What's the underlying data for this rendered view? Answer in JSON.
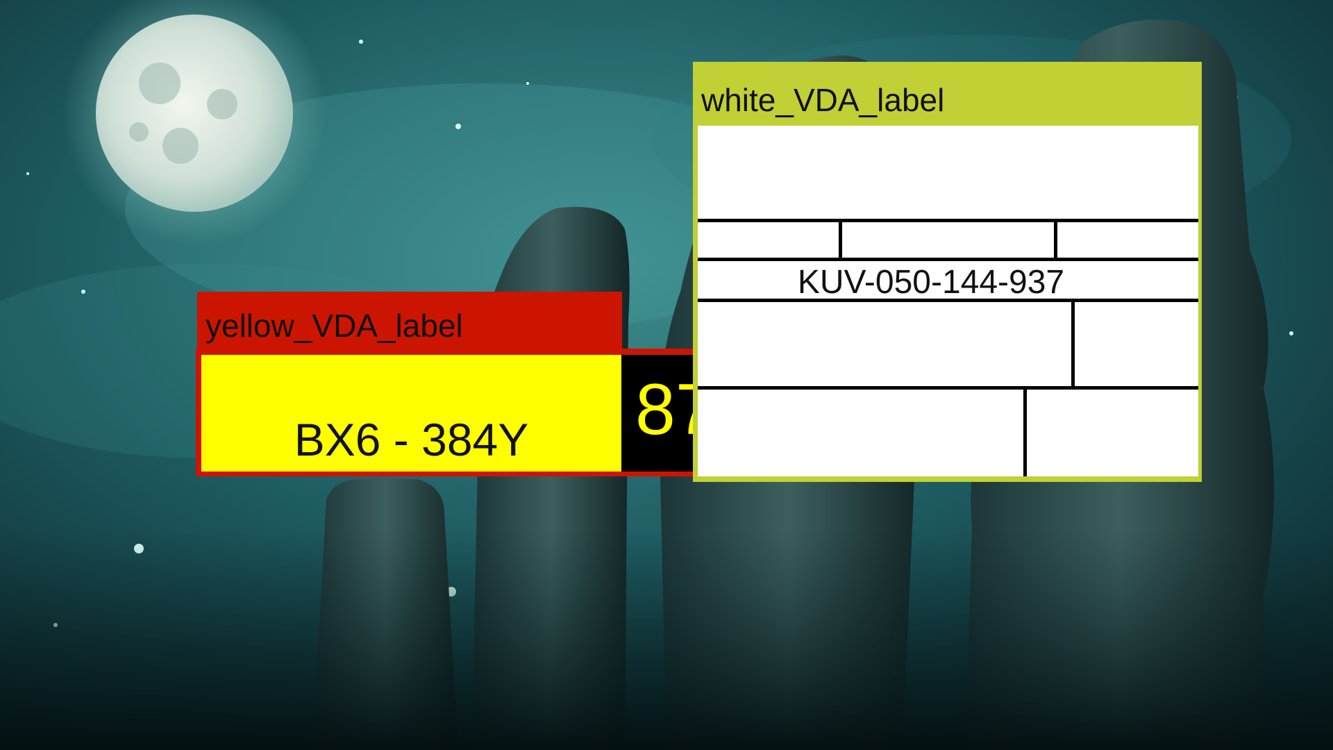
{
  "yellow_label": {
    "header": "yellow_VDA_label",
    "code": "BX6 - 384Y",
    "number": "87",
    "colors": {
      "frame": "#cc1500",
      "field": "#ffff00",
      "number_bg": "#000000",
      "number_text": "#ffff00"
    }
  },
  "white_label": {
    "header": "white_VDA_label",
    "code": "KUV-050-144-937",
    "colors": {
      "frame": "#c1d035",
      "field": "#ffffff",
      "lines": "#000000"
    }
  }
}
